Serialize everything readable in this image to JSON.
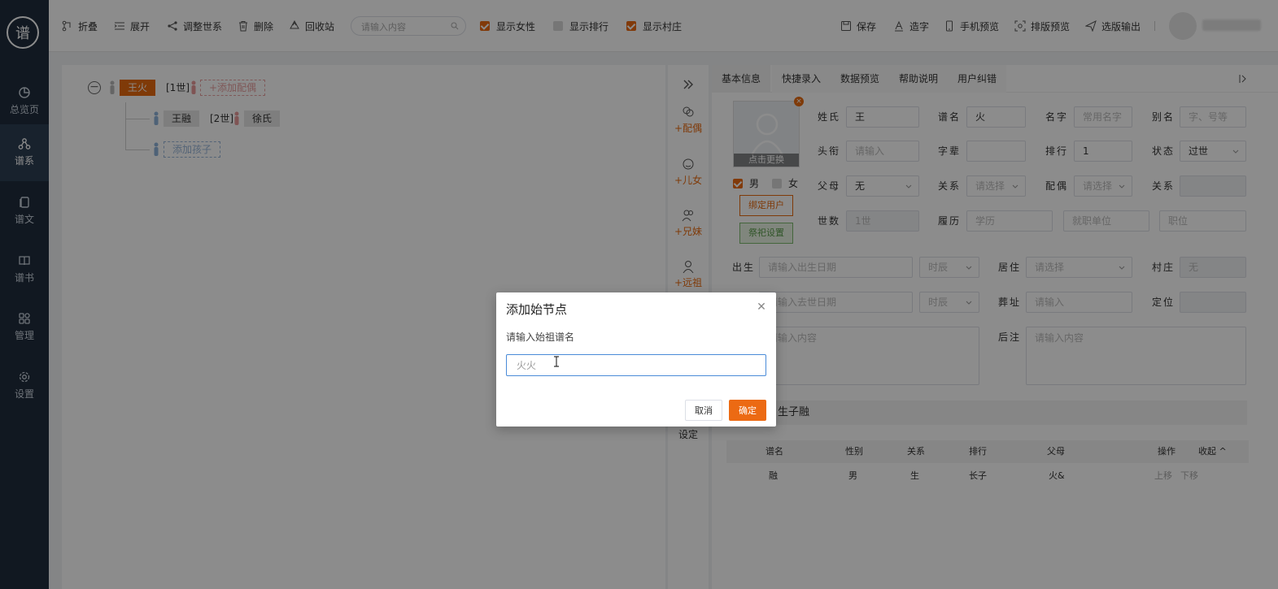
{
  "sidebar": {
    "logo_text": "谱",
    "items": [
      {
        "label": "总览页",
        "icon": "pie-chart-icon"
      },
      {
        "label": "谱系",
        "icon": "tree-nodes-icon"
      },
      {
        "label": "谱文",
        "icon": "document-icon"
      },
      {
        "label": "谱书",
        "icon": "book-icon"
      },
      {
        "label": "管理",
        "icon": "grid-icon"
      },
      {
        "label": "设置",
        "icon": "gear-icon"
      }
    ]
  },
  "toolbar": {
    "fold": "折叠",
    "expand": "展开",
    "adjust_generation": "调整世系",
    "delete": "删除",
    "recycle": "回收站",
    "search_placeholder": "请输入内容",
    "show_female": "显示女性",
    "show_rank": "显示排行",
    "show_village": "显示村庄",
    "save": "保存",
    "make_char": "造字",
    "mobile_preview": "手机预览",
    "layout_preview": "排版预览",
    "output": "选版输出"
  },
  "tree": {
    "root_name": "王火",
    "root_gen": "[1世]",
    "add_spouse": "+添加配偶",
    "child_name": "王融",
    "child_gen": "[2世]",
    "child_spouse": "徐氏",
    "add_child": "添加孩子"
  },
  "midbar": {
    "spouse": "+配偶",
    "children": "+儿女",
    "siblings": "+兄妹",
    "ancestor": "+远祖",
    "settings": "设定"
  },
  "tabs": [
    "基本信息",
    "快捷录入",
    "数据预览",
    "帮助说明",
    "用户纠错"
  ],
  "form": {
    "photo_caption": "点击更换",
    "male": "男",
    "female": "女",
    "bind_user": "绑定用户",
    "worship_settings": "祭祀设置",
    "surname_label": "姓氏",
    "surname_value": "王",
    "pu_name_label": "谱名",
    "pu_name_value": "火",
    "given_name_label": "名字",
    "given_name_placeholder": "常用名字",
    "alias_label": "别名",
    "alias_placeholder": "字、号等",
    "title_label": "头衔",
    "title_placeholder": "请输入",
    "zibei_label": "字辈",
    "zibei_value": "",
    "rank_label": "排行",
    "rank_value": "1",
    "status_label": "状态",
    "status_value": "过世",
    "parent_label": "父母",
    "parent_value": "无",
    "relation_label": "关系",
    "relation_placeholder": "请选择",
    "spouse_label": "配偶",
    "spouse_placeholder": "请选择",
    "relation2_label": "关系",
    "generation_label": "世数",
    "generation_value": "1世",
    "resume_label": "履历",
    "edu_placeholder": "学历",
    "employer_placeholder": "就职单位",
    "position_placeholder": "职位",
    "birth_label": "出生",
    "birth_placeholder": "请输入出生日期",
    "shichen_placeholder": "时辰",
    "residence_label": "居住",
    "residence_placeholder": "请选择",
    "village_label": "村庄",
    "village_value": "无",
    "death_placeholder": "请输入去世日期",
    "shichen2_placeholder": "时辰",
    "burial_label": "葬址",
    "burial_placeholder": "请输入",
    "locate_label": "定位",
    "note_placeholder": "请输入内容",
    "postnote_label": "后注",
    "postnote_placeholder": "请输入内容"
  },
  "summary_text": "，生子融",
  "children_table": {
    "headers": [
      "谱名",
      "性别",
      "关系",
      "排行",
      "父母",
      "操作",
      "收起 ^"
    ],
    "rows": [
      {
        "name": "融",
        "gender": "男",
        "relation": "生",
        "rank": "长子",
        "parents": "火&",
        "up": "上移",
        "down": "下移"
      }
    ]
  },
  "dialog": {
    "title": "添加始节点",
    "label": "请输入始祖谱名",
    "input_value": "火火",
    "cancel": "取消",
    "ok": "确定"
  },
  "colors": {
    "accent": "#ec6a13",
    "sidebar": "#1f2d3d"
  }
}
